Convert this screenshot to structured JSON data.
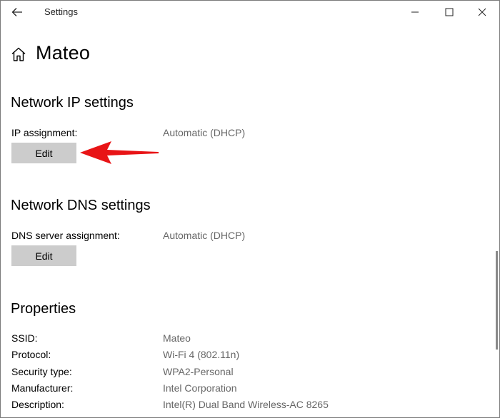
{
  "titlebar": {
    "title": "Settings",
    "back_icon": "back-arrow-icon",
    "controls": [
      "minimize-icon",
      "maximize-icon",
      "close-icon"
    ]
  },
  "header": {
    "icon": "home-icon",
    "title": "Mateo"
  },
  "network_ip": {
    "section_title": "Network IP settings",
    "assignment_label": "IP assignment:",
    "assignment_value": "Automatic (DHCP)",
    "edit_label": "Edit"
  },
  "network_dns": {
    "section_title": "Network DNS settings",
    "assignment_label": "DNS server assignment:",
    "assignment_value": "Automatic (DHCP)",
    "edit_label": "Edit"
  },
  "properties": {
    "section_title": "Properties",
    "rows": [
      {
        "label": "SSID:",
        "value": "Mateo"
      },
      {
        "label": "Protocol:",
        "value": "Wi-Fi 4 (802.11n)"
      },
      {
        "label": "Security type:",
        "value": "WPA2-Personal"
      },
      {
        "label": "Manufacturer:",
        "value": "Intel Corporation"
      },
      {
        "label": "Description:",
        "value": "Intel(R) Dual Band Wireless-AC 8265"
      }
    ]
  },
  "annotation": {
    "arrow_color": "#e81416"
  }
}
